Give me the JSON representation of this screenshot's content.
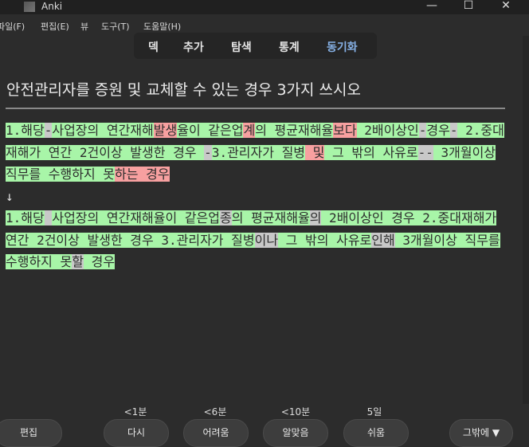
{
  "window": {
    "title": "Anki",
    "min": "—",
    "max": "☐",
    "close": "✕"
  },
  "menu": [
    {
      "label": "파일(F)"
    },
    {
      "label": "편집(E)"
    },
    {
      "label": "뷰"
    },
    {
      "label": "도구(T)"
    },
    {
      "label": "도움말(H)"
    }
  ],
  "toolbar": [
    {
      "label": "덱"
    },
    {
      "label": "추가"
    },
    {
      "label": "탐색"
    },
    {
      "label": "통계"
    },
    {
      "label": "동기화"
    }
  ],
  "card": {
    "question": "안전관리자를 증원 및 교체할 수 있는 경우 3가지 쓰시오",
    "typed_answer": [
      {
        "t": "1.해당",
        "k": "good"
      },
      {
        "t": "-",
        "k": "miss"
      },
      {
        "t": "사업장의 연간재해",
        "k": "good"
      },
      {
        "t": "발생",
        "k": "bad"
      },
      {
        "t": "율이 같은업",
        "k": "good"
      },
      {
        "t": "계",
        "k": "bad"
      },
      {
        "t": "의 평균재해율",
        "k": "good"
      },
      {
        "t": "보다",
        "k": "bad"
      },
      {
        "t": " 2배이상인",
        "k": "good"
      },
      {
        "t": "-",
        "k": "miss"
      },
      {
        "t": "경우",
        "k": "good"
      },
      {
        "t": "-",
        "k": "miss"
      },
      {
        "t": " 2.중대재해가 연간 2건이상 발생한 경우 ",
        "k": "good"
      },
      {
        "t": "-",
        "k": "miss"
      },
      {
        "t": "3.관리자가 질병",
        "k": "good"
      },
      {
        "t": " 및",
        "k": "bad"
      },
      {
        "t": " 그 밖의 사유로",
        "k": "good"
      },
      {
        "t": "--",
        "k": "miss"
      },
      {
        "t": " 3개월이상 직무를 수행하지 못",
        "k": "good"
      },
      {
        "t": "하는 경우",
        "k": "bad"
      },
      {
        "t": " ",
        "k": "good"
      }
    ],
    "arrow": "↓",
    "correct_answer": [
      {
        "t": "1.해당",
        "k": "good"
      },
      {
        "t": " ",
        "k": "miss"
      },
      {
        "t": "사업장의 연간재해율이 같은업",
        "k": "good"
      },
      {
        "t": "종",
        "k": "miss"
      },
      {
        "t": "의 평균재해율",
        "k": "good"
      },
      {
        "t": "의",
        "k": "miss"
      },
      {
        "t": " 2배이상인 경우 ",
        "k": "good"
      },
      {
        "t": " ",
        "k": "miss"
      },
      {
        "t": "2.중대재해가 연간 2건이상 발생한 경우 ",
        "k": "good"
      },
      {
        "t": " ",
        "k": "miss"
      },
      {
        "t": "3.관리자가 질병",
        "k": "good"
      },
      {
        "t": "이나",
        "k": "miss"
      },
      {
        "t": " 그 밖의 사유로",
        "k": "good"
      },
      {
        "t": "인해",
        "k": "miss"
      },
      {
        "t": " 3개월이상 직무를 수행하지 못",
        "k": "good"
      },
      {
        "t": "할",
        "k": "miss"
      },
      {
        "t": " 경우",
        "k": "good"
      }
    ]
  },
  "intervals": [
    "<1분",
    "<6분",
    "<10분",
    "5일"
  ],
  "buttons": {
    "edit": "편집",
    "again": "다시",
    "hard": "어려움",
    "good": "알맞음",
    "easy": "쉬움",
    "more": "그밖에 ▼"
  },
  "colors": {
    "good": "#a8f5a8",
    "bad": "#f7a0a0",
    "missing": "#c8c8c8",
    "sync": "#86b1e6"
  }
}
